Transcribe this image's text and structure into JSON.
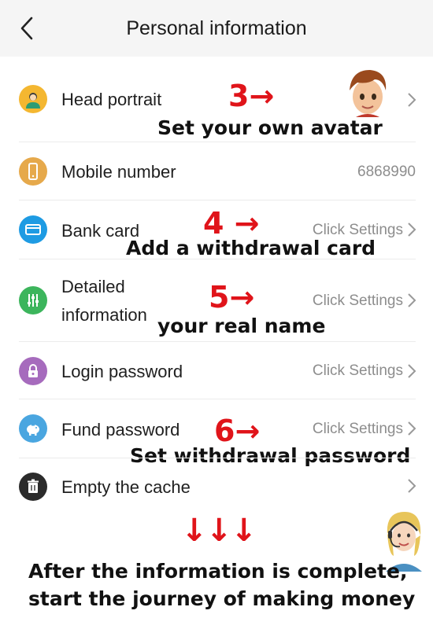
{
  "header": {
    "title": "Personal information"
  },
  "rows": [
    {
      "label": "Head portrait",
      "value": ""
    },
    {
      "label": "Mobile number",
      "value": "6868990"
    },
    {
      "label": "Bank card",
      "value": "Click Settings"
    },
    {
      "label_line1": "Detailed",
      "label_line2": "information",
      "value": "Click Settings"
    },
    {
      "label": "Login password",
      "value": "Click Settings"
    },
    {
      "label": "Fund password",
      "value": "Click Settings"
    },
    {
      "label": "Empty the cache",
      "value": ""
    }
  ],
  "annotations": {
    "step3": "3→",
    "note3": "Set your own avatar",
    "step4": "4 →",
    "note4": "Add a withdrawal card",
    "step5": "5→",
    "note5": "your real name",
    "step6": "6→",
    "note6": "Set withdrawal password",
    "arrows_down": "↓↓↓",
    "footer_line1": "After the information is complete,",
    "footer_line2": "start the journey of making money"
  },
  "colors": {
    "accent_red": "#e0141a",
    "icon_head": "#f4b731",
    "icon_mobile": "#e6a94b",
    "icon_bank": "#1e9be3",
    "icon_detail": "#3cb55c",
    "icon_login": "#a66bbd",
    "icon_fund": "#4aa6e0",
    "icon_cache": "#2b2b2b"
  },
  "icons": [
    "back-arrow-icon",
    "person-icon",
    "phone-icon",
    "card-icon",
    "sliders-icon",
    "lock-icon",
    "piggy-bank-icon",
    "trash-icon",
    "chevron-right-icon"
  ]
}
